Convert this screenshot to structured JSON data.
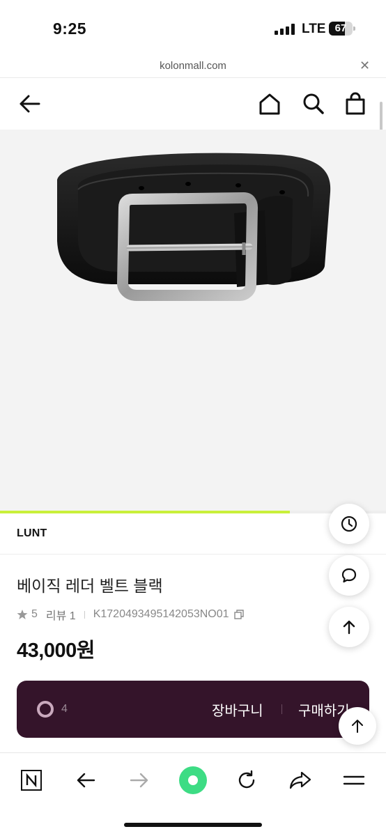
{
  "status_bar": {
    "time": "9:25",
    "network": "LTE",
    "battery": "67",
    "battery_level": 0.67,
    "signal_bars": 4
  },
  "browser": {
    "url": "kolonmall.com",
    "close_icon": "close-icon"
  },
  "header": {
    "icons": [
      "back-arrow-icon",
      "home-icon",
      "search-icon",
      "shopping-bag-icon"
    ]
  },
  "product": {
    "image": "black-leather-belt-photo",
    "gallery_progress": 0.75,
    "brand": "LUNT",
    "title": "베이직 레더 벨트 블랙",
    "rating": "5",
    "review_label": "리뷰 1",
    "product_code": "K1720493495142053NO01",
    "price": "43,000원"
  },
  "purchase_bar": {
    "like_count": "4",
    "cart_label": "장바구니",
    "buy_label": "구매하기",
    "background_color": "#34142a"
  },
  "floating_buttons": [
    "history-clock-icon",
    "chat-bubble-icon",
    "scroll-top-arrow-icon",
    "scroll-top-arrow-icon"
  ],
  "toolbar": {
    "icons": [
      "naver-n-icon",
      "back-icon",
      "forward-icon",
      "green-dot-home-icon",
      "refresh-icon",
      "share-icon",
      "menu-icon"
    ],
    "accent_color": "#3ddc84"
  },
  "colors": {
    "progress": "#c9f03a",
    "text": "#111111"
  }
}
